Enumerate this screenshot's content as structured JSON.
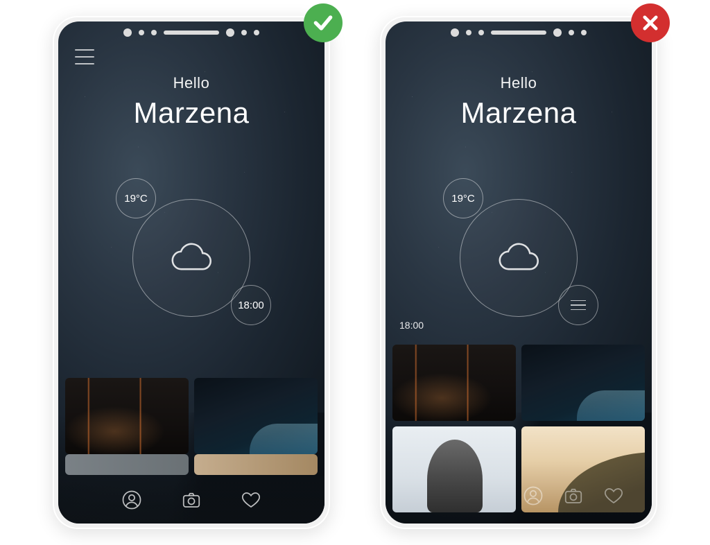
{
  "badges": {
    "good": "check",
    "bad": "x"
  },
  "left": {
    "greeting": {
      "hello": "Hello",
      "name": "Marzena"
    },
    "weather": {
      "temp": "19°C",
      "time": "18:00"
    },
    "nav": {
      "items": [
        "profile",
        "camera",
        "heart"
      ]
    },
    "gallery": {
      "row1": [
        "bridge-night",
        "ocean-wave-night"
      ]
    }
  },
  "right": {
    "greeting": {
      "hello": "Hello",
      "name": "Marzena"
    },
    "weather": {
      "temp": "19°C"
    },
    "floating_time": "18:00",
    "nav": {
      "items": [
        "profile",
        "camera",
        "heart"
      ]
    },
    "gallery": {
      "row1": [
        "bridge-night",
        "ocean-wave-night"
      ],
      "row2": [
        "dog-snow",
        "sunset-hill"
      ]
    }
  }
}
